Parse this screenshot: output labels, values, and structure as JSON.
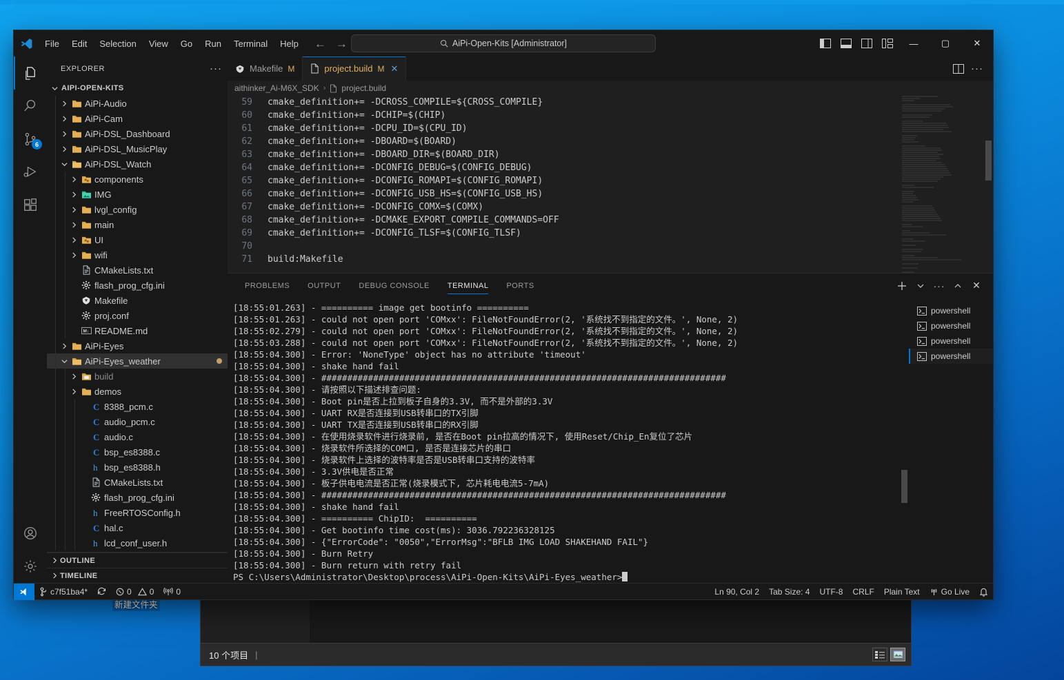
{
  "desktop": {
    "new_folder_label": "新建文件夹"
  },
  "bg_explorer": {
    "status_count": "10 个项目",
    "status_sep": "|"
  },
  "titlebar": {
    "logo": "vscode-logo-icon",
    "menus": [
      "File",
      "Edit",
      "Selection",
      "View",
      "Go",
      "Run",
      "Terminal",
      "Help"
    ],
    "nav_back": "arrow-left-icon",
    "nav_forward": "arrow-right-icon",
    "command_center": {
      "icon": "search-icon",
      "text": "AiPi-Open-Kits [Administrator]"
    },
    "layout_buttons": [
      "toggle-primary-sidebar-icon",
      "toggle-panel-icon",
      "toggle-secondary-sidebar-icon",
      "customize-layout-icon"
    ],
    "window_minimize": "—",
    "window_maximize": "▢",
    "window_close": "✕"
  },
  "activitybar": {
    "items": [
      {
        "name": "explorer",
        "icon": "files-icon",
        "active": true,
        "badge": ""
      },
      {
        "name": "search",
        "icon": "search-icon",
        "active": false,
        "badge": ""
      },
      {
        "name": "source-control",
        "icon": "source-control-icon",
        "active": false,
        "badge": "6"
      },
      {
        "name": "run-and-debug",
        "icon": "run-debug-icon",
        "active": false,
        "badge": ""
      },
      {
        "name": "extensions",
        "icon": "extensions-icon",
        "active": false,
        "badge": ""
      }
    ],
    "bottom": [
      {
        "name": "accounts",
        "icon": "account-icon"
      },
      {
        "name": "settings",
        "icon": "gear-icon"
      }
    ]
  },
  "sidebar": {
    "title": "EXPLORER",
    "more_actions": "···",
    "tree": [
      {
        "label": "AIPI-OPEN-KITS",
        "depth": 0,
        "type": "root",
        "chev": "down",
        "icon": "none"
      },
      {
        "label": "AiPi-Audio",
        "depth": 1,
        "type": "folder",
        "chev": "right",
        "icon": "folder"
      },
      {
        "label": "AiPi-Cam",
        "depth": 1,
        "type": "folder",
        "chev": "right",
        "icon": "folder"
      },
      {
        "label": "AiPi-DSL_Dashboard",
        "depth": 1,
        "type": "folder",
        "chev": "right",
        "icon": "folder"
      },
      {
        "label": "AiPi-DSL_MusicPlay",
        "depth": 1,
        "type": "folder",
        "chev": "right",
        "icon": "folder"
      },
      {
        "label": "AiPi-DSL_Watch",
        "depth": 1,
        "type": "folder",
        "chev": "down",
        "icon": "folder-open"
      },
      {
        "label": "components",
        "depth": 2,
        "type": "folder",
        "chev": "right",
        "icon": "folder-components"
      },
      {
        "label": "IMG",
        "depth": 2,
        "type": "folder",
        "chev": "right",
        "icon": "folder-img"
      },
      {
        "label": "lvgl_config",
        "depth": 2,
        "type": "folder",
        "chev": "right",
        "icon": "folder"
      },
      {
        "label": "main",
        "depth": 2,
        "type": "folder",
        "chev": "right",
        "icon": "folder"
      },
      {
        "label": "UI",
        "depth": 2,
        "type": "folder",
        "chev": "right",
        "icon": "folder-components"
      },
      {
        "label": "wifi",
        "depth": 2,
        "type": "folder",
        "chev": "right",
        "icon": "folder"
      },
      {
        "label": "CMakeLists.txt",
        "depth": 2,
        "type": "file",
        "chev": "none",
        "icon": "txt"
      },
      {
        "label": "flash_prog_cfg.ini",
        "depth": 2,
        "type": "file",
        "chev": "none",
        "icon": "gear"
      },
      {
        "label": "Makefile",
        "depth": 2,
        "type": "file",
        "chev": "none",
        "icon": "makefile"
      },
      {
        "label": "proj.conf",
        "depth": 2,
        "type": "file",
        "chev": "none",
        "icon": "gear"
      },
      {
        "label": "README.md",
        "depth": 2,
        "type": "file",
        "chev": "none",
        "icon": "markdown"
      },
      {
        "label": "AiPi-Eyes",
        "depth": 1,
        "type": "folder",
        "chev": "right",
        "icon": "folder"
      },
      {
        "label": "AiPi-Eyes_weather",
        "depth": 1,
        "type": "folder",
        "chev": "down",
        "icon": "folder-open",
        "selected": true,
        "dot": true
      },
      {
        "label": "build",
        "depth": 2,
        "type": "folder",
        "chev": "right",
        "icon": "folder-build",
        "dimmed": true
      },
      {
        "label": "demos",
        "depth": 2,
        "type": "folder",
        "chev": "right",
        "icon": "folder"
      },
      {
        "label": "8388_pcm.c",
        "depth": 3,
        "type": "file",
        "chev": "none",
        "icon": "c"
      },
      {
        "label": "audio_pcm.c",
        "depth": 3,
        "type": "file",
        "chev": "none",
        "icon": "c"
      },
      {
        "label": "audio.c",
        "depth": 3,
        "type": "file",
        "chev": "none",
        "icon": "c"
      },
      {
        "label": "bsp_es8388.c",
        "depth": 3,
        "type": "file",
        "chev": "none",
        "icon": "c"
      },
      {
        "label": "bsp_es8388.h",
        "depth": 3,
        "type": "file",
        "chev": "none",
        "icon": "h"
      },
      {
        "label": "CMakeLists.txt",
        "depth": 3,
        "type": "file",
        "chev": "none",
        "icon": "txt"
      },
      {
        "label": "flash_prog_cfg.ini",
        "depth": 3,
        "type": "file",
        "chev": "none",
        "icon": "gear"
      },
      {
        "label": "FreeRTOSConfig.h",
        "depth": 3,
        "type": "file",
        "chev": "none",
        "icon": "h"
      },
      {
        "label": "hal.c",
        "depth": 3,
        "type": "file",
        "chev": "none",
        "icon": "c"
      },
      {
        "label": "lcd_conf_user.h",
        "depth": 3,
        "type": "file",
        "chev": "none",
        "icon": "h"
      }
    ],
    "sections": [
      {
        "label": "OUTLINE",
        "chev": "right"
      },
      {
        "label": "TIMELINE",
        "chev": "right"
      }
    ]
  },
  "editor": {
    "tabs": [
      {
        "label": "Makefile",
        "icon": "makefile-icon",
        "modified": "M",
        "active": false,
        "closable": false
      },
      {
        "label": "project.build",
        "icon": "file-icon",
        "modified": "M",
        "active": true,
        "closable": true
      }
    ],
    "tab_actions": [
      "split-editor-icon",
      "more-actions-icon"
    ],
    "breadcrumb": [
      "aithinker_Ai-M6X_SDK",
      "project.build"
    ],
    "lines": [
      {
        "no": "59",
        "text": "cmake_definition+= -DCROSS_COMPILE=${CROSS_COMPILE}"
      },
      {
        "no": "60",
        "text": "cmake_definition+= -DCHIP=$(CHIP)"
      },
      {
        "no": "61",
        "text": "cmake_definition+= -DCPU_ID=$(CPU_ID)"
      },
      {
        "no": "62",
        "text": "cmake_definition+= -DBOARD=$(BOARD)"
      },
      {
        "no": "63",
        "text": "cmake_definition+= -DBOARD_DIR=$(BOARD_DIR)"
      },
      {
        "no": "64",
        "text": "cmake_definition+= -DCONFIG_DEBUG=$(CONFIG_DEBUG)"
      },
      {
        "no": "65",
        "text": "cmake_definition+= -DCONFIG_ROMAPI=$(CONFIG_ROMAPI)"
      },
      {
        "no": "66",
        "text": "cmake_definition+= -DCONFIG_USB_HS=$(CONFIG_USB_HS)"
      },
      {
        "no": "67",
        "text": "cmake_definition+= -DCONFIG_COMX=$(COMX)"
      },
      {
        "no": "68",
        "text": "cmake_definition+= -DCMAKE_EXPORT_COMPILE_COMMANDS=OFF"
      },
      {
        "no": "69",
        "text": "cmake_definition+= -DCONFIG_TLSF=$(CONFIG_TLSF)"
      },
      {
        "no": "70",
        "text": ""
      },
      {
        "no": "71",
        "text": "build:Makefile"
      }
    ]
  },
  "panel": {
    "tabs": [
      {
        "label": "PROBLEMS",
        "active": false
      },
      {
        "label": "OUTPUT",
        "active": false
      },
      {
        "label": "DEBUG CONSOLE",
        "active": false
      },
      {
        "label": "TERMINAL",
        "active": true
      },
      {
        "label": "PORTS",
        "active": false
      }
    ],
    "actions": [
      "add-terminal-icon",
      "chevron-down-icon",
      "more-actions-icon",
      "maximize-panel-icon",
      "close-panel-icon"
    ],
    "terminal_list": [
      {
        "label": "powershell",
        "icon": "terminal-powershell-icon",
        "active": false
      },
      {
        "label": "powershell",
        "icon": "terminal-powershell-icon",
        "active": false
      },
      {
        "label": "powershell",
        "icon": "terminal-powershell-icon",
        "active": false
      },
      {
        "label": "powershell",
        "icon": "terminal-powershell-icon",
        "active": true
      }
    ],
    "terminal_lines": [
      "[18:55:01.263] - ========== image get bootinfo ==========",
      "[18:55:01.263] - could not open port 'COMxx': FileNotFoundError(2, '系统找不到指定的文件。', None, 2)",
      "[18:55:02.279] - could not open port 'COMxx': FileNotFoundError(2, '系统找不到指定的文件。', None, 2)",
      "[18:55:03.288] - could not open port 'COMxx': FileNotFoundError(2, '系统找不到指定的文件。', None, 2)",
      "[18:55:04.300] - Error: 'NoneType' object has no attribute 'timeout'",
      "[18:55:04.300] - shake hand fail",
      "[18:55:04.300] - ##############################################################################",
      "[18:55:04.300] - 请按照以下描述排查问题:",
      "[18:55:04.300] - Boot pin是否上拉到板子自身的3.3V, 而不是外部的3.3V",
      "[18:55:04.300] - UART RX是否连接到USB转串口的TX引脚",
      "[18:55:04.300] - UART TX是否连接到USB转串口的RX引脚",
      "[18:55:04.300] - 在使用烧录软件进行烧录前, 是否在Boot pin拉高的情况下, 使用Reset/Chip_En复位了芯片",
      "[18:55:04.300] - 烧录软件所选择的COM口, 是否是连接芯片的串口",
      "[18:55:04.300] - 烧录软件上选择的波特率是否是USB转串口支持的波特率",
      "[18:55:04.300] - 3.3V供电是否正常",
      "[18:55:04.300] - 板子供电电流是否正常(烧录模式下, 芯片耗电电流5-7mA)",
      "[18:55:04.300] - ##############################################################################",
      "[18:55:04.300] - shake hand fail",
      "[18:55:04.300] - ========== ChipID:  ==========",
      "[18:55:04.300] - Get bootinfo time cost(ms): 3036.792236328125",
      "[18:55:04.300] - {\"ErrorCode\": \"0050\",\"ErrorMsg\":\"BFLB IMG LOAD SHAKEHAND FAIL\"}",
      "[18:55:04.300] - Burn Retry",
      "[18:55:04.300] - Burn return with retry fail"
    ],
    "prompt": "PS C:\\Users\\Administrator\\Desktop\\process\\AiPi-Open-Kits\\AiPi-Eyes_weather>"
  },
  "statusbar": {
    "remote_icon": "remote-window-icon",
    "left": [
      {
        "name": "branch",
        "icon": "git-branch-icon",
        "label": "c7f51ba4*"
      },
      {
        "name": "sync",
        "icon": "sync-icon",
        "label": ""
      },
      {
        "name": "errors",
        "icon": "error-icon",
        "label": "0"
      },
      {
        "name": "warnings",
        "icon": "warning-icon",
        "label": "0"
      },
      {
        "name": "ports",
        "icon": "radio-tower-icon",
        "label": "0"
      }
    ],
    "right": [
      {
        "name": "cursor-position",
        "icon": "",
        "label": "Ln 90, Col 2"
      },
      {
        "name": "tab-size",
        "icon": "",
        "label": "Tab Size: 4"
      },
      {
        "name": "encoding",
        "icon": "",
        "label": "UTF-8"
      },
      {
        "name": "eol",
        "icon": "",
        "label": "CRLF"
      },
      {
        "name": "language-mode",
        "icon": "",
        "label": "Plain Text"
      },
      {
        "name": "go-live",
        "icon": "broadcast-icon",
        "label": "Go Live"
      },
      {
        "name": "notifications",
        "icon": "bell-icon",
        "label": ""
      }
    ]
  },
  "colors": {
    "accent": "#0078d4",
    "tab_active_text": "#e0b060",
    "bg": "#1f1f1f",
    "chrome": "#181818",
    "desktop": "#0a84d8"
  }
}
